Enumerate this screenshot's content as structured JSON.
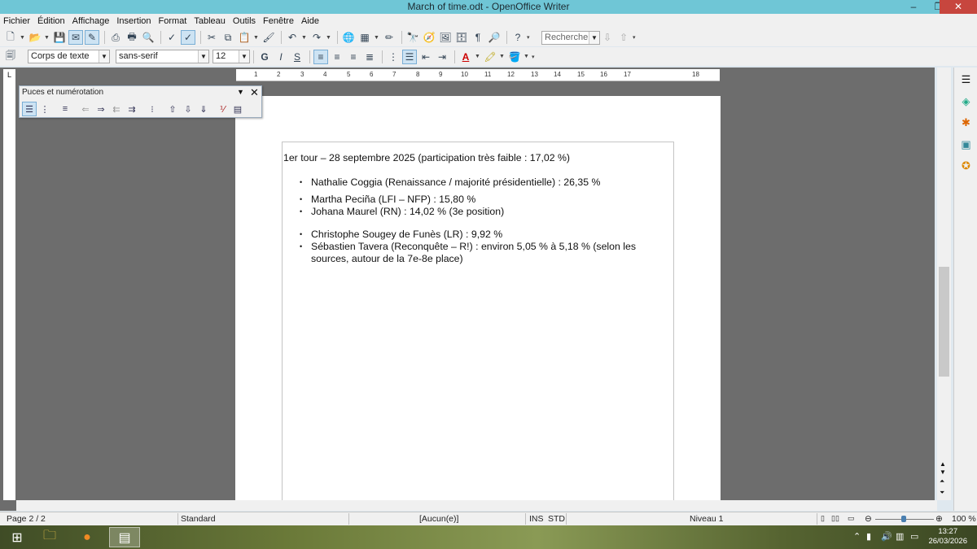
{
  "window": {
    "title": "March of time.odt - OpenOffice Writer",
    "minimize": "–",
    "restore": "❐",
    "close": "✕"
  },
  "menu": [
    "Fichier",
    "Édition",
    "Affichage",
    "Insertion",
    "Format",
    "Tableau",
    "Outils",
    "Fenêtre",
    "Aide"
  ],
  "toolbar": {
    "search_placeholder": "Rechercher"
  },
  "formatting": {
    "style": "Corps de texte",
    "font": "sans-serif",
    "size": "12",
    "bold": "G",
    "italic": "I",
    "underline": "S",
    "font_color_letter": "A"
  },
  "panel": {
    "title": "Puces et numérotation"
  },
  "ruler": {
    "marks": [
      "1",
      "2",
      "3",
      "4",
      "5",
      "6",
      "7",
      "8",
      "9",
      "10",
      "11",
      "12",
      "13",
      "14",
      "15",
      "16",
      "17",
      "18"
    ],
    "corner": "L"
  },
  "document": {
    "heading": "1er tour – 28 septembre 2025 (participation très faible : 17,02 %)",
    "bullet": "•",
    "items": [
      "Nathalie Coggia (Renaissance / majorité présidentielle) : 26,35 %",
      "Martha Peciña (LFI – NFP) : 15,80 %",
      "Johana Maurel (RN) : 14,02 % (3e position)",
      "Christophe Sougey de Funès (LR) : 9,92 %",
      "Sébastien Tavera (Reconquête – R!) : environ 5,05 % à 5,18 % (selon les sources, autour de la 7e-8e place)"
    ]
  },
  "status": {
    "page": "Page 2 / 2",
    "style": "Standard",
    "language": "[Aucun(e)]",
    "insert": "INS",
    "selection": "STD",
    "level": "Niveau 1",
    "zoom": "100 %"
  },
  "taskbar": {
    "time": "13:27",
    "date": "26/03/2026"
  },
  "colors": {
    "titlebar": "#6fc6d6",
    "close": "#c7463e",
    "workspace": "#6d6d6d"
  }
}
